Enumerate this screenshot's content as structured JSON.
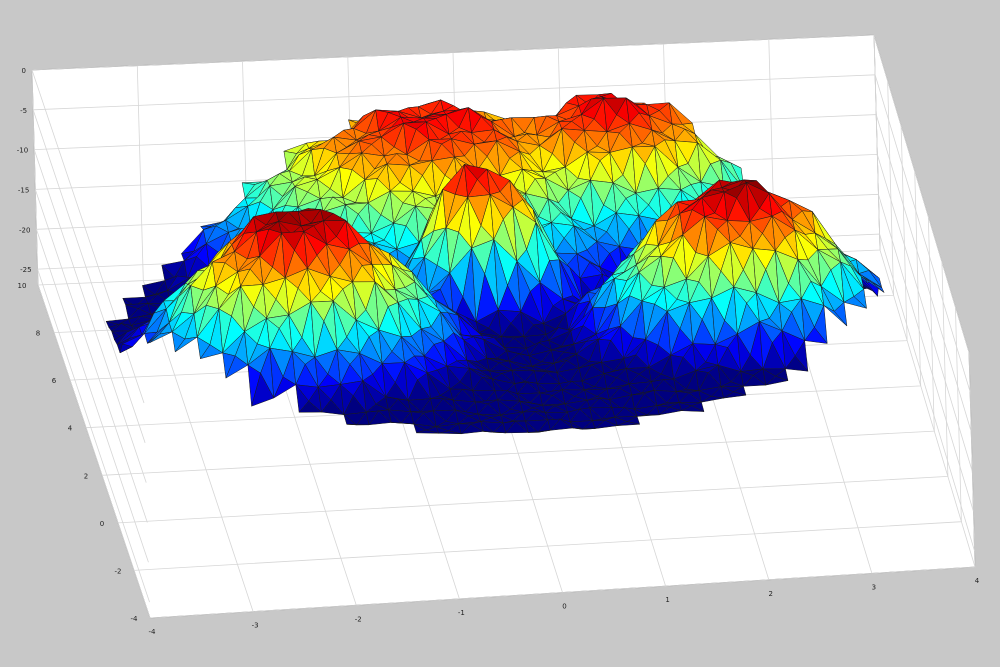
{
  "figure": {
    "background": "#c8c8c8",
    "axes_face": "#ffffff",
    "grid_color": "#d6d6d6",
    "edge_color": "#1a1a1a"
  },
  "chart_data": {
    "type": "surface",
    "title": "",
    "xlabel": "",
    "ylabel": "",
    "zlabel": "",
    "grid": true,
    "colormap": "jet",
    "shading": "faceted triangles",
    "xlim": [
      -4,
      4
    ],
    "ylim": [
      -4,
      10
    ],
    "zlim": [
      -27,
      0
    ],
    "x_ticks": [
      "-4",
      "-3",
      "-2",
      "-1",
      "0",
      "1",
      "2",
      "3",
      "4"
    ],
    "y_ticks": [
      "10",
      "8",
      "6",
      "4",
      "2",
      "0",
      "-2",
      "-4"
    ],
    "z_ticks": [
      "0",
      "-5",
      "-10",
      "-15",
      "-20",
      "-25"
    ],
    "surface": {
      "description_of_shape": "heightfield with a ridge ring, a central peak and two large lobes toward the front",
      "resolution": [
        34,
        24
      ],
      "peaks": [
        {
          "x": -1.9,
          "y": 4.2,
          "height": -2.0,
          "spread": 1.6
        },
        {
          "x": 2.3,
          "y": 4.6,
          "height": -2.2,
          "spread": 1.5
        },
        {
          "x": 0.0,
          "y": 6.2,
          "height": -3.0,
          "spread": 0.9
        },
        {
          "x": -0.3,
          "y": 8.7,
          "height": -4.0,
          "spread": 2.5
        },
        {
          "x": 1.4,
          "y": 8.9,
          "height": -3.5,
          "spread": 1.8
        }
      ],
      "base_height": -27
    }
  }
}
